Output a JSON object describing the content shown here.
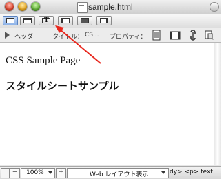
{
  "window": {
    "title": "sample.html"
  },
  "toolbar_top": {
    "buttons": [
      {
        "name": "layout-view",
        "active": true
      },
      {
        "name": "split-view",
        "active": false
      },
      {
        "name": "text-view",
        "label": "T",
        "active": false
      },
      {
        "name": "list-view",
        "active": false
      },
      {
        "name": "image-view",
        "active": false
      },
      {
        "name": "pdf-view",
        "active": false
      }
    ]
  },
  "toolbar_second": {
    "header_label": "ヘッダ",
    "title_label": "タイトル：",
    "title_value": "CS...",
    "property_label": "プロパティ："
  },
  "content": {
    "heading1": "CSS Sample Page",
    "heading2": "スタイルシートサンプル"
  },
  "statusbar": {
    "zoom": "100%",
    "minus": "−",
    "plus": "+",
    "view_mode": "Web レイアウト表示",
    "path": "dy> <p> text"
  },
  "colors": {
    "annotation_arrow": "#e8281e",
    "active_button": "#8fb3e8"
  }
}
